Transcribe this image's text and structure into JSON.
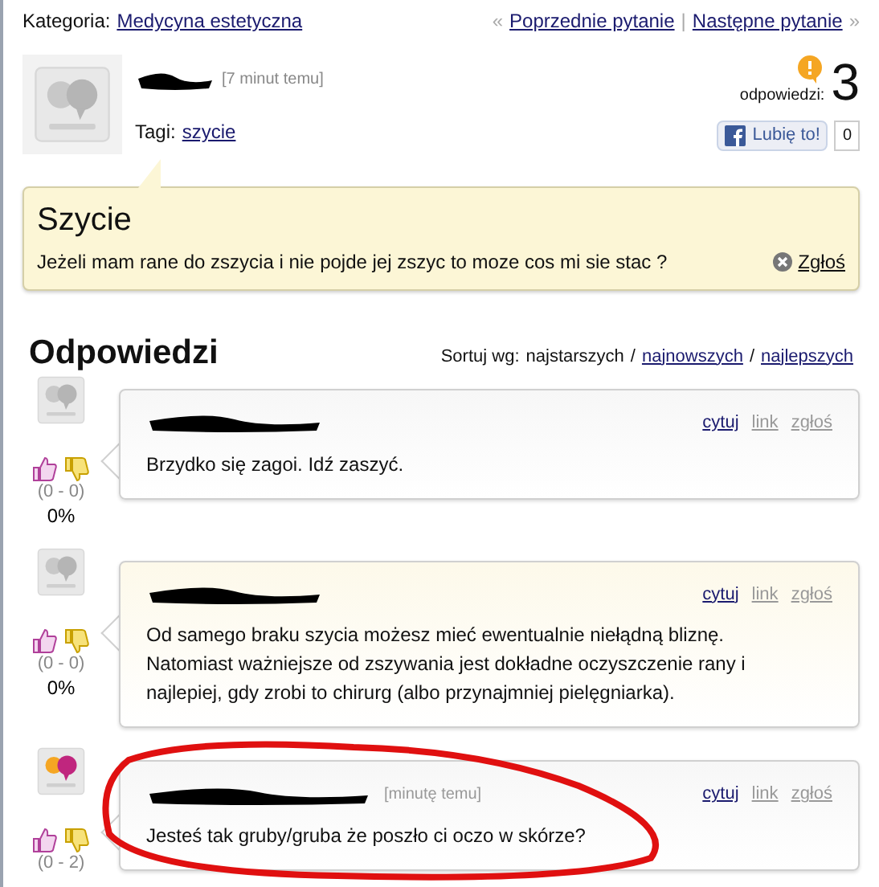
{
  "header": {
    "category_label": "Kategoria:",
    "category": "Medycyna estetyczna",
    "prev": "Poprzednie pytanie",
    "next": "Następne pytanie",
    "prev_mark": "«",
    "next_mark": "»",
    "separator": "|"
  },
  "question": {
    "time": "[7 minut temu]",
    "tags_label": "Tagi:",
    "tags": [
      "szycie"
    ],
    "answers_label": "odpowiedzi:",
    "answers_count": "3",
    "like_label": "Lubię to!",
    "like_count": "0",
    "title": "Szycie",
    "body": "Jeżeli mam rane do zszycia i nie pojde jej zszyc to moze cos mi sie stac ?",
    "report": "Zgłoś"
  },
  "answers_heading": "Odpowiedzi",
  "sort": {
    "label": "Sortuj wg:",
    "separator": "/",
    "options": [
      {
        "label": "najstarszych",
        "selected": true
      },
      {
        "label": "najnowszych",
        "selected": false
      },
      {
        "label": "najlepszych",
        "selected": false
      }
    ]
  },
  "answers": [
    {
      "avatar": {
        "kind": "plain"
      },
      "text": "Brzydko się zagoi. Idź zaszyć.",
      "votes": "(0 - 0)",
      "percent": "0%",
      "circled": false,
      "actions": [
        {
          "label": "cytuj",
          "kind": "active"
        },
        {
          "label": "link",
          "kind": "muted"
        },
        {
          "label": "zgłoś",
          "kind": "muted"
        }
      ]
    },
    {
      "avatar": {
        "kind": "plain"
      },
      "text": "Od samego braku szycia możesz mieć ewentualnie niełądną bliznę. Natomiast ważniejsze od zszywania jest dokładne oczyszczenie rany i najlepiej, gdy zrobi to chirurg (albo przynajmniej pielęgniarka).",
      "votes": "(0 - 0)",
      "percent": "0%",
      "circled": false,
      "actions": [
        {
          "label": "cytuj",
          "kind": "active"
        },
        {
          "label": "link",
          "kind": "muted"
        },
        {
          "label": "zgłoś",
          "kind": "muted"
        }
      ]
    },
    {
      "avatar": {
        "kind": "colored"
      },
      "time": "[minutę temu]",
      "text": "Jesteś tak gruby/gruba że poszło ci oczo w skórze?",
      "votes": "(0 - 2)",
      "circled": true,
      "actions": [
        {
          "label": "cytuj",
          "kind": "active"
        },
        {
          "label": "link",
          "kind": "muted"
        },
        {
          "label": "zgłoś",
          "kind": "muted"
        }
      ]
    }
  ]
}
